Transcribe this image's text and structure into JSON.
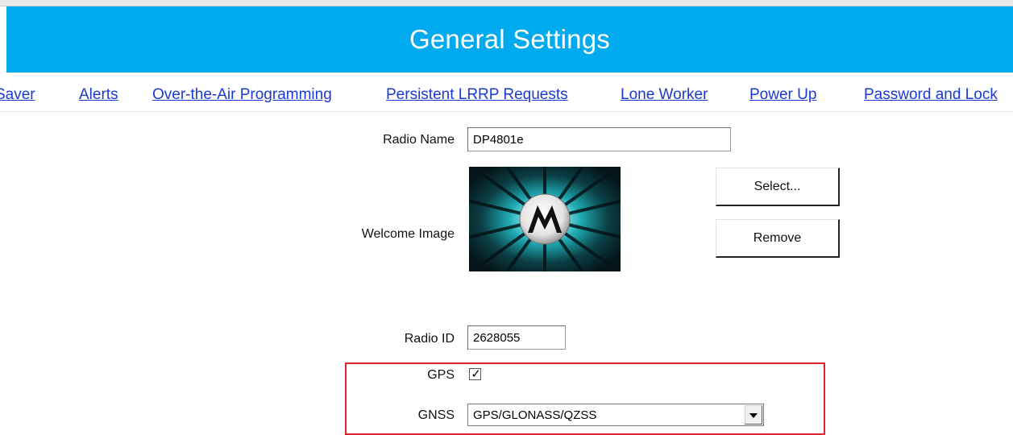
{
  "header": {
    "title": "General Settings"
  },
  "nav": {
    "tabs": [
      {
        "label": "Saver"
      },
      {
        "label": "Alerts"
      },
      {
        "label": "Over-the-Air Programming"
      },
      {
        "label": "Persistent LRRP Requests"
      },
      {
        "label": "Lone Worker"
      },
      {
        "label": "Power Up"
      },
      {
        "label": "Password and Lock"
      }
    ]
  },
  "form": {
    "radio_name": {
      "label": "Radio Name",
      "value": "DP4801e"
    },
    "welcome_image": {
      "label": "Welcome Image",
      "image_icon": "motorola-logo-icon",
      "select_label": "Select...",
      "remove_label": "Remove"
    },
    "radio_id": {
      "label": "Radio ID",
      "value": "2628055"
    },
    "gps": {
      "label": "GPS",
      "checked": true
    },
    "gnss": {
      "label": "GNSS",
      "value": "GPS/GLONASS/QZSS"
    }
  },
  "colors": {
    "banner": "#00aaee",
    "link": "#1a3ad6",
    "highlight": "#e0242c"
  }
}
